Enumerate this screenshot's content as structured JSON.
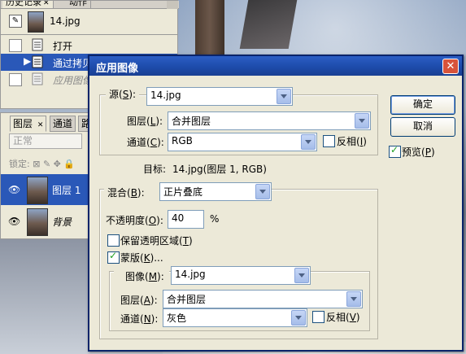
{
  "history_panel": {
    "tabs": [
      "历史记录",
      "动作"
    ],
    "snapshot_label": "14.jpg",
    "items": [
      "打开",
      "通过拷贝",
      "应用图像"
    ]
  },
  "layers_panel": {
    "tabs": [
      "图层",
      "通道",
      "路"
    ],
    "blend_mode": "正常",
    "lock_label": "锁定:",
    "layers": [
      "图层 1",
      "背景"
    ]
  },
  "dialog": {
    "title": "应用图像",
    "close_glyph": "✕",
    "source": {
      "label_prefix": "源(",
      "key": "S",
      "label_suffix": "):",
      "value": "14.jpg"
    },
    "src_layer": {
      "label_prefix": "图层(",
      "key": "L",
      "label_suffix": "):",
      "value": "合并图层"
    },
    "src_channel": {
      "label_prefix": "通道(",
      "key": "C",
      "label_suffix": "):",
      "value": "RGB"
    },
    "invert1": {
      "label_prefix": "反相(",
      "key": "I",
      "label_suffix": ")",
      "checked": false
    },
    "target": {
      "label": "目标:",
      "value": "14.jpg(图层 1, RGB)"
    },
    "blending": {
      "label_prefix": "混合(",
      "key": "B",
      "label_suffix": "):",
      "value": "正片叠底"
    },
    "opacity": {
      "label_prefix": "不透明度(",
      "key": "O",
      "label_suffix": "):",
      "value": "40",
      "unit": "%"
    },
    "preserve": {
      "label_prefix": "保留透明区域(",
      "key": "T",
      "label_suffix": ")",
      "checked": false
    },
    "mask": {
      "label_prefix": "蒙版(",
      "key": "K",
      "label_suffix": ")...",
      "checked": true
    },
    "mask_image": {
      "label_prefix": "图像(",
      "key": "M",
      "label_suffix": "):",
      "value": "14.jpg"
    },
    "mask_layer": {
      "label_prefix": "图层(",
      "key": "A",
      "label_suffix": "):",
      "value": "合并图层"
    },
    "mask_channel": {
      "label_prefix": "通道(",
      "key": "N",
      "label_suffix": "):",
      "value": "灰色"
    },
    "invert2": {
      "label_prefix": "反相(",
      "key": "V",
      "label_suffix": ")",
      "checked": false
    },
    "buttons": {
      "ok": "确定",
      "cancel": "取消"
    },
    "preview": {
      "label_prefix": "预览(",
      "key": "P",
      "label_suffix": ")",
      "checked": true
    }
  }
}
